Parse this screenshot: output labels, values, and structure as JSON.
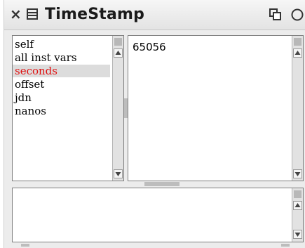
{
  "window": {
    "title": "TimeStamp"
  },
  "inspector": {
    "fields": [
      {
        "label": "self",
        "selected": false
      },
      {
        "label": "all inst vars",
        "selected": false
      },
      {
        "label": "seconds",
        "selected": true
      },
      {
        "label": "offset",
        "selected": false
      },
      {
        "label": "jdn",
        "selected": false
      },
      {
        "label": "nanos",
        "selected": false
      }
    ],
    "value": "65056",
    "evaluator_text": ""
  },
  "icons": {
    "close": "close-icon",
    "menu": "window-menu-icon",
    "collapse": "collapse-icon",
    "expand": "expand-icon"
  },
  "colors": {
    "selected_text": "#e01010",
    "selection_bg": "#dcdcdc",
    "window_bg": "#ececec"
  }
}
